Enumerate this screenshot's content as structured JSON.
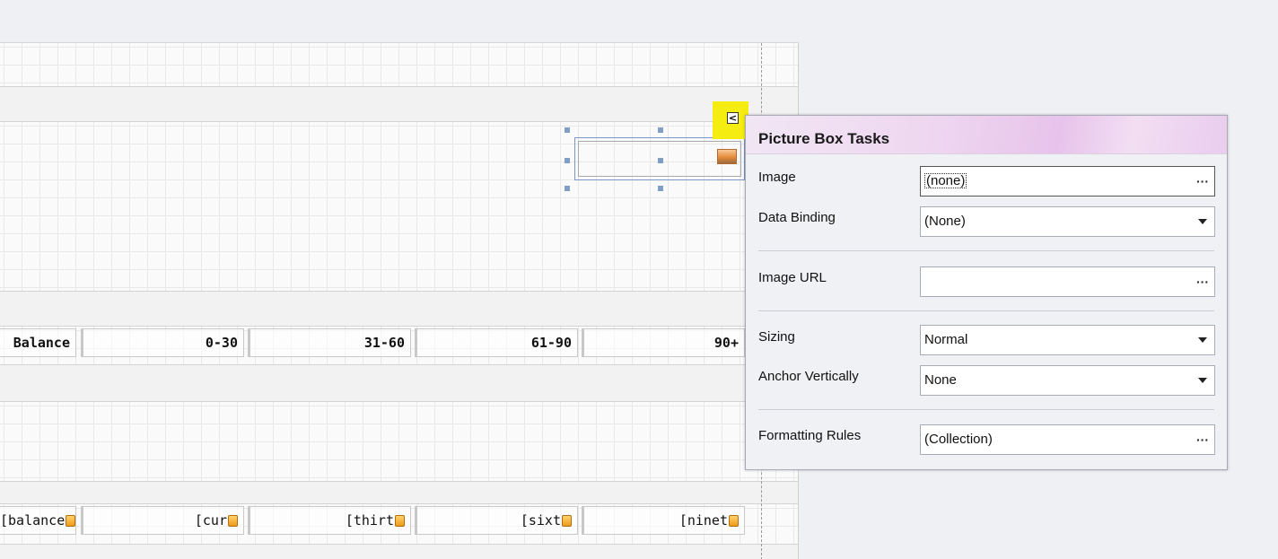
{
  "report": {
    "header_row": [
      "Balance",
      "0-30",
      "31-60",
      "61-90",
      "90+"
    ],
    "data_row": [
      "[balance",
      "[cur",
      "[thirt",
      "[sixt",
      "[ninet"
    ]
  },
  "tasks_panel": {
    "title": "Picture Box Tasks",
    "rows": {
      "image": {
        "label": "Image",
        "value": "(none)",
        "button": "···"
      },
      "data_binding": {
        "label": "Data Binding",
        "value": "(None)"
      },
      "image_url": {
        "label": "Image URL",
        "value": "",
        "button": "···"
      },
      "sizing": {
        "label": "Sizing",
        "value": "Normal"
      },
      "anchor_vertically": {
        "label": "Anchor Vertically",
        "value": "None"
      },
      "formatting_rules": {
        "label": "Formatting Rules",
        "value": "(Collection)",
        "button": "···"
      }
    }
  },
  "smart_tag": {
    "glyph": "<",
    "highlight_color": "#f5ec12"
  },
  "icons": [
    "picture-icon",
    "smart-tag-icon",
    "database-field-icon",
    "ellipsis-icon",
    "dropdown-caret-icon"
  ]
}
